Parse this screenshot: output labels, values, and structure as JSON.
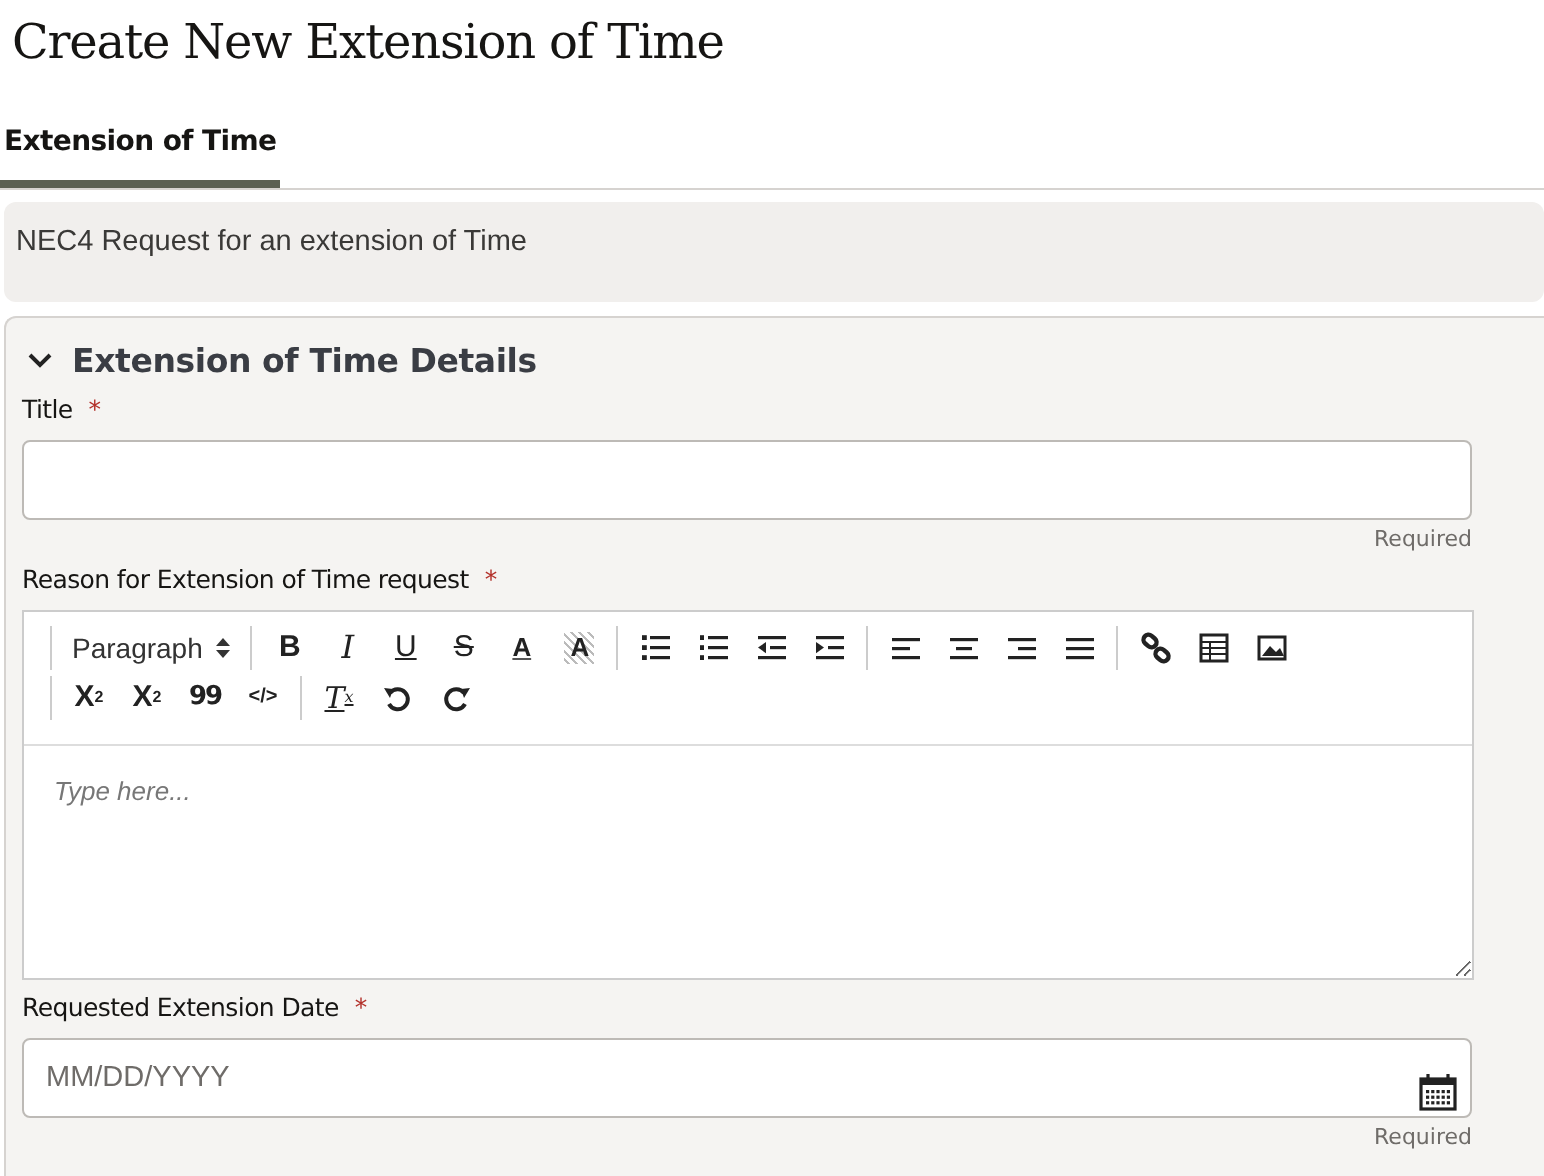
{
  "page": {
    "title": "Create New Extension of Time"
  },
  "tabs": [
    {
      "label": "Extension of Time",
      "selected": true
    }
  ],
  "description": "NEC4 Request for an extension of Time",
  "section": {
    "title": "Extension of Time Details",
    "expanded": true,
    "fields": [
      {
        "kind": "text",
        "label": "Title",
        "required_mark": "*",
        "hint": "Required"
      },
      {
        "kind": "editor",
        "label": "Reason for Extension of Time request",
        "required_mark": "*",
        "placeholder": "Type here...",
        "format_select": "Paragraph",
        "toolbar_rows": [
          [
            {
              "kind": "sep"
            },
            {
              "kind": "format"
            },
            {
              "kind": "sep"
            },
            {
              "kind": "bold",
              "glyph": "B"
            },
            {
              "kind": "italic",
              "glyph": "I"
            },
            {
              "kind": "underline",
              "glyph": "U"
            },
            {
              "kind": "strike",
              "glyph": "S"
            },
            {
              "kind": "color",
              "glyph": "A"
            },
            {
              "kind": "bgcolor",
              "glyph": "A"
            },
            {
              "kind": "sep"
            },
            {
              "kind": "bullets"
            },
            {
              "kind": "numbers"
            },
            {
              "kind": "outdent"
            },
            {
              "kind": "indent"
            },
            {
              "kind": "sep"
            },
            {
              "kind": "left"
            },
            {
              "kind": "center"
            },
            {
              "kind": "right"
            },
            {
              "kind": "justify"
            },
            {
              "kind": "sep"
            },
            {
              "kind": "link"
            },
            {
              "kind": "table"
            },
            {
              "kind": "image"
            }
          ],
          [
            {
              "kind": "sep"
            },
            {
              "kind": "sub",
              "glyph": "X",
              "small": "2"
            },
            {
              "kind": "sup",
              "glyph": "X",
              "small": "2"
            },
            {
              "kind": "quote",
              "glyph": "99"
            },
            {
              "kind": "code",
              "glyph": "</>"
            },
            {
              "kind": "sep"
            },
            {
              "kind": "clear",
              "glyph": "T",
              "small": "x"
            },
            {
              "kind": "undo"
            },
            {
              "kind": "redo"
            }
          ]
        ]
      },
      {
        "kind": "date",
        "label": "Requested Extension Date",
        "required_mark": "*",
        "placeholder": "MM/DD/YYYY",
        "hint": "Required"
      }
    ]
  }
}
